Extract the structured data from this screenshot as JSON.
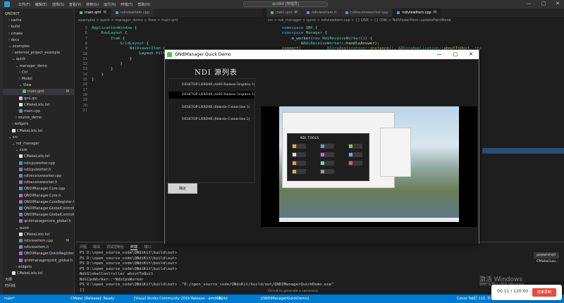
{
  "titlebar": {
    "menu": [
      "文件(F)",
      "编辑(E)",
      "选择(S)",
      "查看(V)",
      "转到(G)",
      "运行(R)",
      "终端(T)",
      "帮助(H)"
    ],
    "nav": "← →",
    "search": "qndikit [管理员]",
    "controls": [
      "—",
      "▢",
      "✕"
    ]
  },
  "explorer": {
    "rows": [
      {
        "label": "QNDIKIT",
        "indent": 0,
        "kind": "root"
      },
      {
        "label": "cache",
        "indent": 1,
        "kind": "folder"
      },
      {
        "label": "build",
        "indent": 1,
        "kind": "folder"
      },
      {
        "label": "cmake",
        "indent": 1,
        "kind": "folder"
      },
      {
        "label": "docs",
        "indent": 1,
        "kind": "folder"
      },
      {
        "label": "examples",
        "indent": 1,
        "kind": "folder-open"
      },
      {
        "label": "external_project_example",
        "indent": 2,
        "kind": "folder"
      },
      {
        "label": "quick",
        "indent": 2,
        "kind": "folder-open"
      },
      {
        "label": "manager_demo",
        "indent": 3,
        "kind": "folder-open"
      },
      {
        "label": "Ctrl",
        "indent": 4,
        "kind": "folder"
      },
      {
        "label": "Model",
        "indent": 4,
        "kind": "folder"
      },
      {
        "label": "View",
        "indent": 4,
        "kind": "folder-open"
      },
      {
        "label": "main.qml",
        "indent": 5,
        "kind": "qml",
        "mark": "M",
        "selected": true
      },
      {
        "label": "qml.qrc",
        "indent": 4,
        "kind": "file"
      },
      {
        "label": "CMakeLists.txt",
        "indent": 4,
        "kind": "cmake"
      },
      {
        "label": "main.cpp",
        "indent": 4,
        "kind": "cpp"
      },
      {
        "label": "source_demo",
        "indent": 3,
        "kind": "folder"
      },
      {
        "label": "widgets",
        "indent": 2,
        "kind": "folder"
      },
      {
        "label": "CMakeLists.txt",
        "indent": 2,
        "kind": "cmake"
      },
      {
        "label": "src",
        "indent": 1,
        "kind": "folder-open"
      },
      {
        "label": "ndi_manager",
        "indent": 2,
        "kind": "folder-open"
      },
      {
        "label": "core",
        "indent": 3,
        "kind": "folder-open"
      },
      {
        "label": "CMakeLists.txt",
        "indent": 4,
        "kind": "cmake"
      },
      {
        "label": "ndicpuworker.cpp",
        "indent": 4,
        "kind": "cpp"
      },
      {
        "label": "ndicpuworker.h",
        "indent": 4,
        "kind": "h"
      },
      {
        "label": "ndireceiveworker.cpp",
        "indent": 4,
        "kind": "cpp"
      },
      {
        "label": "ndireceiveworker.h",
        "indent": 4,
        "kind": "h"
      },
      {
        "label": "QNDIManager.Core.cpp",
        "indent": 4,
        "kind": "cpp"
      },
      {
        "label": "QNDIManager.Core.h",
        "indent": 4,
        "kind": "h"
      },
      {
        "label": "QNDIManager.CoreRegister.h",
        "indent": 4,
        "kind": "h"
      },
      {
        "label": "QNDIManager.GlobalControlle...",
        "indent": 4,
        "kind": "cpp"
      },
      {
        "label": "QNDIManager.GlobalControlle...",
        "indent": 4,
        "kind": "h"
      },
      {
        "label": "qndimanagercore_global.h",
        "indent": 4,
        "kind": "h"
      },
      {
        "label": "quick",
        "indent": 3,
        "kind": "folder-open"
      },
      {
        "label": "CMakeLists.txt",
        "indent": 4,
        "kind": "cmake"
      },
      {
        "label": "ndiviewitem.cpp",
        "indent": 4,
        "kind": "cpp",
        "mark": "M"
      },
      {
        "label": "ndiviewitem.h",
        "indent": 4,
        "kind": "h"
      },
      {
        "label": "QNDIManager.QuickRegister.h",
        "indent": 4,
        "kind": "h"
      },
      {
        "label": "qndimanagerquick_global.h",
        "indent": 4,
        "kind": "h"
      },
      {
        "label": "widgets",
        "indent": 3,
        "kind": "folder"
      },
      {
        "label": "CMakeLists.txt",
        "indent": 2,
        "kind": "cmake"
      },
      {
        "label": "大纲",
        "indent": 0,
        "kind": "section"
      },
      {
        "label": "时间线",
        "indent": 0,
        "kind": "section"
      }
    ]
  },
  "editor_left": {
    "tabs": [
      {
        "label": "main.qml",
        "mark": "M",
        "active": true
      },
      {
        "label": "ndiviewitem.cpp",
        "mark": "",
        "active": false
      }
    ],
    "breadcrumb": "examples > quick > manager_demo > View > main.qml",
    "line_numbers": [
      "5",
      "6",
      "7",
      "8",
      "9",
      "10",
      "11",
      "12",
      "13",
      "14",
      "15",
      "16",
      "17",
      "18",
      "19",
      "20",
      "21"
    ],
    "lines": [
      "ApplicationWindow {",
      "    RowLayout {",
      "        Item {",
      "            GridLayout {",
      "                NdiViewerItem {",
      "                    Layout.fill...",
      "                }",
      "            }",
      "        }",
      "    }",
      "}",
      "",
      "",
      "",
      "",
      "",
      ""
    ]
  },
  "editor_right": {
    "tabs": [
      {
        "label": "main.qml",
        "mark": "M",
        "active": false
      },
      {
        "label": "ndiviewitem.h",
        "mark": "",
        "active": false
      },
      {
        "label": "ndireceiveworker.cpp",
        "mark": "",
        "active": false
      },
      {
        "label": "ndiviewitem.cpp",
        "mark": "M",
        "active": true
      }
    ],
    "breadcrumb": "src > ndi_manager > quick > ndiviewitem.cpp > {} QNK > {} QNK > NdiViewerItem::updatePaintNode",
    "lines": [
      "namespace QNK {",
      "namespace Manager {",
      "    m_worker(new NdiReceiveWorker()) {",
      "        &NdiReceiveWorker::handleAnswer);",
      "connect(           QCoreApplication::instance(), &QCoreApplication::aboutToQuit, this,"
    ]
  },
  "panel": {
    "tabs": [
      "问题",
      "输出",
      "调试控制台",
      "终端",
      "端口"
    ],
    "active_tab": "终端",
    "terminal_lines": [
      "PS D:\\open_source_code\\QNdiKit\\build\\out>",
      "PS D:\\open_source_code\\QNdiKit\\build\\out>",
      "PS D:\\open_source_code\\QNdiKit\\build\\out>",
      "PS D:\\open_source_code\\QNdiKit\\build\\out>",
      "NdiGlobalController aboutToQuit",
      "NdiCpuWorker::~NdiCpuWorker",
      "PS D:\\open_source_code\\QNdiKit\\build\\out> .\"D:/open_source_code/QNdiKit/build/out/QNDIManagerQuickDemo.exe\"",
      "[]"
    ],
    "terminals": [
      "powershell",
      "CMake/Lau..."
    ]
  },
  "status": {
    "branch": "main*",
    "cmake": "CMake: [Release]: Ready",
    "kit": "[Visual Studio Community 2019 Release - amd64]",
    "build": "Build",
    "target": "[QNDIManagerQuickDemo]",
    "tabinfo": "Conor Tab",
    "pos": "行 110, 列 9",
    "misc": "Win32",
    "hint": "Ctrl+K to generate a command"
  },
  "qt_window": {
    "title": "QNdiManager Quick Demo",
    "controls": [
      "—",
      "▢",
      "✕"
    ],
    "heading": "NDI 源列表",
    "sources": [
      {
        "label": "DESKTOP-LNRD4R (AMD Radeon Graphics 1)",
        "selected": false
      },
      {
        "label": "DESKTOP-LNRD4R (AMD Radeon Graphics 2)",
        "selected": true
      },
      {
        "label": "DESKTOP-LNRD4R (Remote Connection 1)",
        "selected": false
      },
      {
        "label": "DESKTOP-LNRD4R (Remote Connection 2)",
        "selected": false
      }
    ],
    "confirm_label": "确定",
    "preview_title": "NDI TOOLS"
  },
  "recorder": {
    "time": "00:11 / 120:00",
    "button": "结束录制"
  },
  "watermark": {
    "line1": "激活 Windows",
    "line2": "转到\"设置\"以激活 Windows"
  }
}
